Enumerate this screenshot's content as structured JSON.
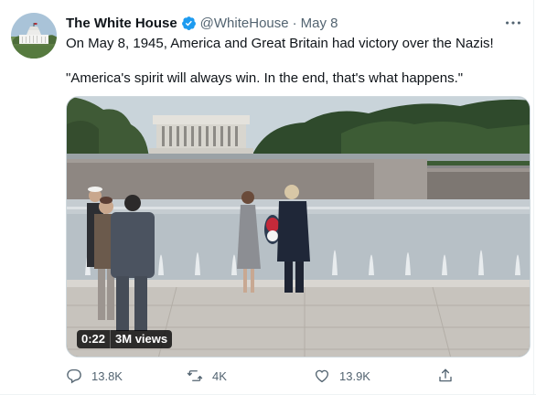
{
  "tweet": {
    "author": {
      "display_name": "The White House",
      "handle": "@WhiteHouse",
      "verified": true,
      "avatar_icon": "white-house-building-icon"
    },
    "separator": "·",
    "date": "May 8",
    "text_line1": "On May 8, 1945, America and Great Britain had victory over the Nazis!",
    "text_line2": "\"America's spirit will always win. In the end, that's what happens.\"",
    "media": {
      "type": "video",
      "duration": "0:22",
      "views": "3M views"
    },
    "actions": {
      "reply": {
        "icon": "reply-icon",
        "count": "13.8K"
      },
      "retweet": {
        "icon": "retweet-icon",
        "count": "4K"
      },
      "like": {
        "icon": "heart-icon",
        "count": "13.9K"
      },
      "share": {
        "icon": "share-icon"
      }
    }
  },
  "colors": {
    "verified_blue": "#1d9bf0",
    "secondary_text": "#536471",
    "primary_text": "#0f1419"
  }
}
